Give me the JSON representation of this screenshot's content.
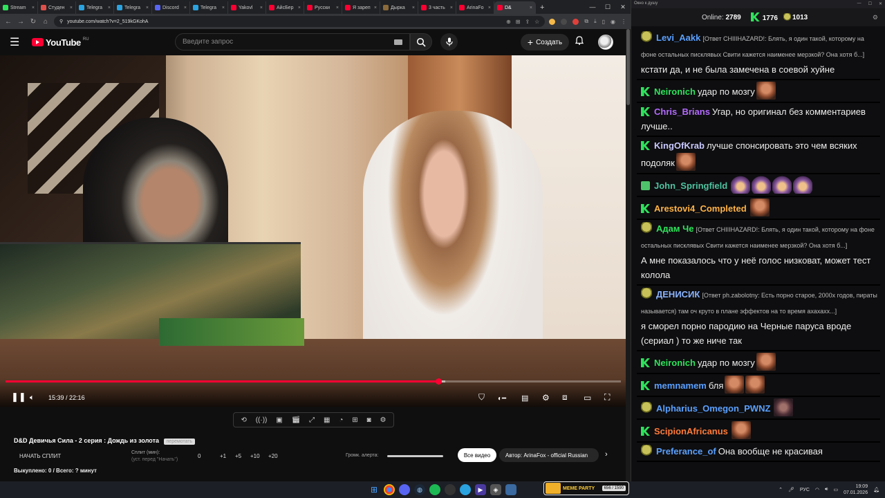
{
  "browser": {
    "tabs": [
      {
        "label": "Stream",
        "color": "#2ee35b"
      },
      {
        "label": "Студен",
        "color": "#e0504a"
      },
      {
        "label": "Telegra",
        "color": "#2aa3e0"
      },
      {
        "label": "Telegra",
        "color": "#2aa3e0"
      },
      {
        "label": "Discord",
        "color": "#5865f2"
      },
      {
        "label": "Telegra",
        "color": "#2aa3e0"
      },
      {
        "label": "Yakovl",
        "color": "#ff0033"
      },
      {
        "label": "АйсБер",
        "color": "#ff0033"
      },
      {
        "label": "Русски",
        "color": "#ff0033"
      },
      {
        "label": "Я зареп",
        "color": "#ff0033"
      },
      {
        "label": "Дырка",
        "color": "#8a6a3a"
      },
      {
        "label": "3 часть",
        "color": "#ff0033"
      },
      {
        "label": "ArinaFo",
        "color": "#ff0033"
      },
      {
        "label": "D&",
        "color": "#ff0033"
      }
    ],
    "url": "youtube.com/watch?v=2_519kGKohA",
    "window_controls": [
      "—",
      "☐",
      "✕"
    ]
  },
  "youtube": {
    "logo_text": "YouTube",
    "logo_region": "RU",
    "search_placeholder": "Введите запрос",
    "create_label": "Создать"
  },
  "player": {
    "time_current": "15:39",
    "time_total": "22:16",
    "progress_fraction": 0.703,
    "buffer_fraction": 0.715
  },
  "below_video": {
    "title": "D&D Девичья Сила - 2 серия : Дождь из золота",
    "title_badge": "перемотать",
    "start_split": "НАЧАТЬ СПЛИТ",
    "split_label": "Сплит (мин):",
    "split_hint": "(уст. перед \"Начать\")",
    "split_values": [
      "0",
      "+1",
      "+5",
      "+10",
      "+20"
    ],
    "alert_label": "Громк. алерта:",
    "all_videos": "Все видео",
    "author_chip": "Автор: ArinaFox - official Russian",
    "bought": "Выкуплено: 0 / Всего: ? минут"
  },
  "chat": {
    "window_title": "Окно к душу",
    "online_label": "Online:",
    "online_count": "2789",
    "k_count": "1776",
    "p_count": "1013",
    "messages": [
      {
        "badge": "pepe",
        "user": "Levi_Aakk",
        "color": "#5aa0ff",
        "reply": "[Ответ CHIIIHAZARD!: Блять, я один такой, которому на фоне остальных писклявых Свити кажется наименее мерзкой? Она хотя б...]",
        "text": "кстати да, и не была замечена в соевой хуйне",
        "emotes": 0,
        "emote_style": ""
      },
      {
        "badge": "k",
        "user": "Neironich",
        "color": "#2ee35b",
        "reply": "",
        "text": "удар по мозгу",
        "emotes": 1,
        "emote_style": ""
      },
      {
        "badge": "k",
        "user": "Chris_Brians",
        "color": "#b46cff",
        "reply": "",
        "text": "Угар, но оригинал без комментариев лучше..",
        "emotes": 0,
        "emote_style": ""
      },
      {
        "badge": "k",
        "user": "KingOfKrab",
        "color": "#c9c9ff",
        "reply": "",
        "text": "лучше спонсировать это чем всяких подоляк",
        "emotes": 1,
        "emote_style": ""
      },
      {
        "badge": "green",
        "user": "John_Springfield",
        "color": "#4fc3a0",
        "reply": "",
        "text": "",
        "emotes": 4,
        "emote_style": "wiz"
      },
      {
        "badge": "k",
        "user": "Arestovi4_Completed",
        "color": "#ffb347",
        "reply": "",
        "text": "",
        "emotes": 1,
        "emote_style": ""
      },
      {
        "badge": "pepe",
        "user": "Адам Че",
        "color": "#2ee35b",
        "reply": "[Ответ CHIIIHAZARD!: Блять, я один такой, которому на фоне остальных писклявых Свити кажется наименее мерзкой? Она хотя б...]",
        "text": "А мне показалось что у неё голос низковат, может тест колола",
        "emotes": 0,
        "emote_style": ""
      },
      {
        "badge": "pepe",
        "user": "ДЕНИСИК",
        "color": "#8ab4ff",
        "reply": "[Ответ ph.zabolotny: Есть порно старое, 2000х годов, пираты называется) там оч круто в плане эффектов на то время ахахахх...]",
        "text": "я сморел порно пародию на Черные паруса вроде (сериал ) то же ниче так",
        "emotes": 0,
        "emote_style": ""
      },
      {
        "badge": "k",
        "user": "Neironich",
        "color": "#2ee35b",
        "reply": "",
        "text": "удар по мозгу",
        "emotes": 1,
        "emote_style": ""
      },
      {
        "badge": "k",
        "user": "memnamem",
        "color": "#5aa0ff",
        "reply": "",
        "text": "бля",
        "emotes": 2,
        "emote_style": ""
      },
      {
        "badge": "pepe",
        "user": "Alpharius_Omegon_PWNZ",
        "color": "#5aa0ff",
        "reply": "",
        "text": "",
        "emotes": 1,
        "emote_style": "dark"
      },
      {
        "badge": "k",
        "user": "ScipionAfricanus",
        "color": "#ff7b3a",
        "reply": "",
        "text": "",
        "emotes": 1,
        "emote_style": ""
      },
      {
        "badge": "pepe",
        "user": "Preferance_of",
        "color": "#5aa0ff",
        "reply": "",
        "text": "Она вообще не красивая",
        "emotes": 0,
        "emote_style": ""
      }
    ]
  },
  "taskbar": {
    "lang": "РУС",
    "time": "19:09",
    "date": "07.01.2026",
    "meme_party_label": "MEME PARTY",
    "meme_party_count": "656 / 1590"
  }
}
